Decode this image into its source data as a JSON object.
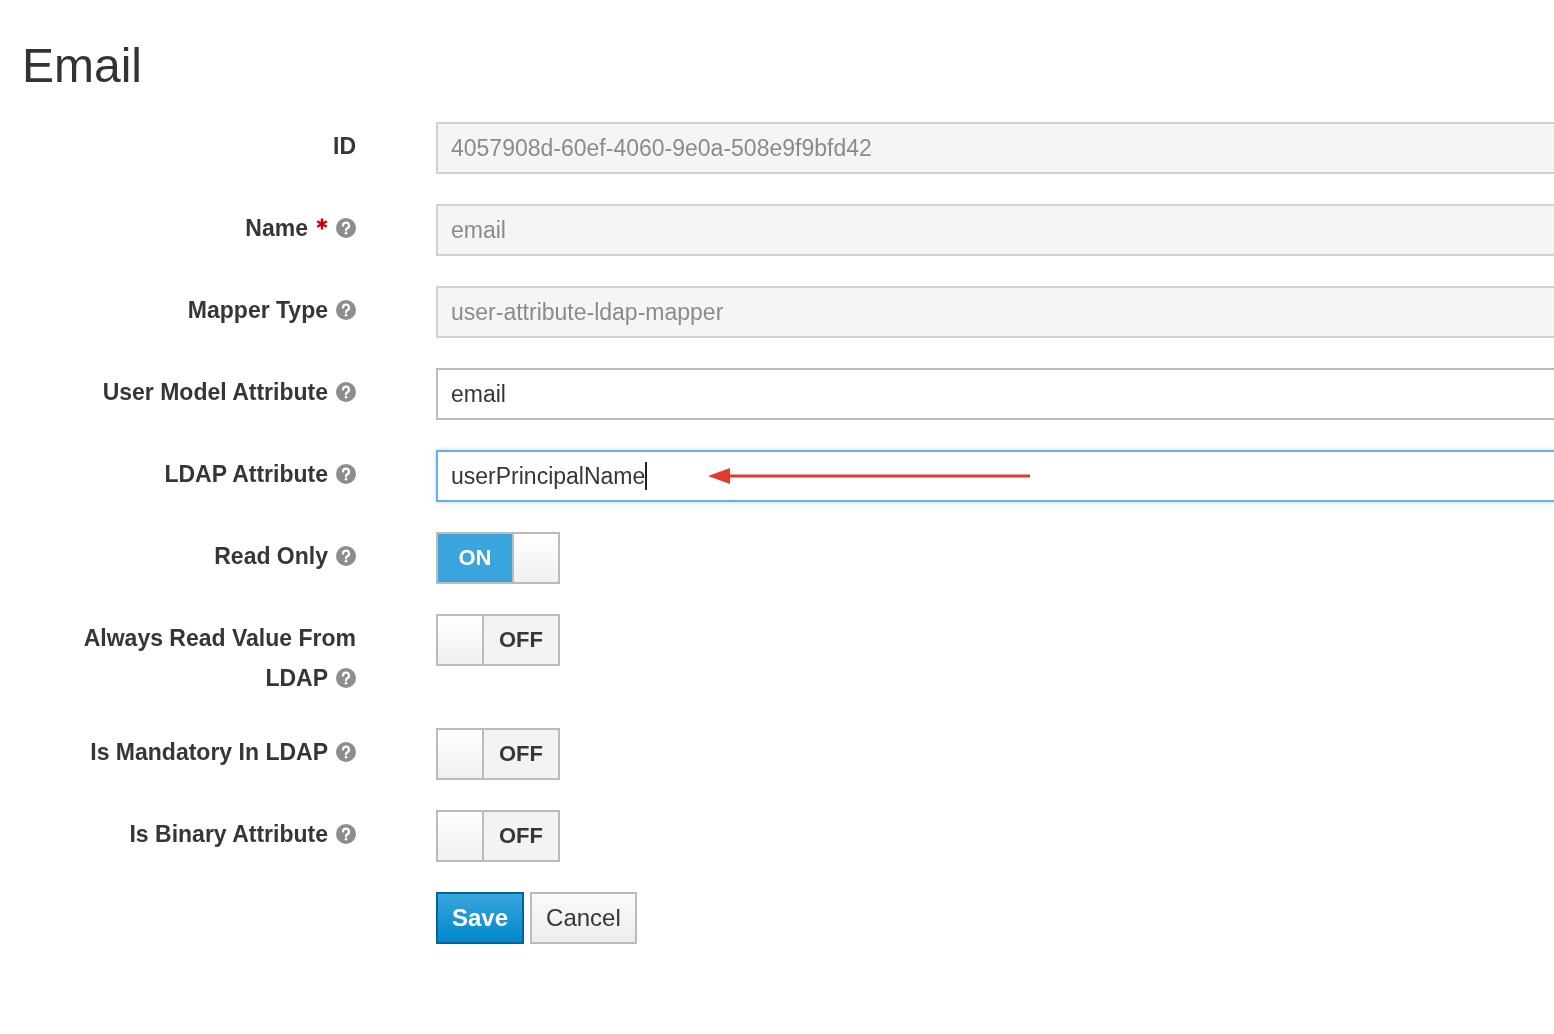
{
  "title": "Email",
  "fields": [
    {
      "kind": "text",
      "label": "ID",
      "required": false,
      "help": false,
      "value": "4057908d-60ef-4060-9e0a-508e9f9bfd42",
      "disabled": true,
      "focused": false,
      "arrow": false
    },
    {
      "kind": "text",
      "label": "Name",
      "required": true,
      "help": true,
      "value": "email",
      "disabled": true,
      "focused": false,
      "arrow": false
    },
    {
      "kind": "text",
      "label": "Mapper Type",
      "required": false,
      "help": true,
      "value": "user-attribute-ldap-mapper",
      "disabled": true,
      "focused": false,
      "arrow": false
    },
    {
      "kind": "text",
      "label": "User Model Attribute",
      "required": false,
      "help": true,
      "value": "email",
      "disabled": false,
      "focused": false,
      "arrow": false
    },
    {
      "kind": "text",
      "label": "LDAP Attribute",
      "required": false,
      "help": true,
      "value": "userPrincipalName",
      "disabled": false,
      "focused": true,
      "arrow": true
    },
    {
      "kind": "switch",
      "label": "Read Only",
      "required": false,
      "help": true,
      "on": true,
      "text": "ON"
    },
    {
      "kind": "switch",
      "label": "Always Read Value From LDAP",
      "required": false,
      "help": true,
      "on": false,
      "text": "OFF"
    },
    {
      "kind": "switch",
      "label": "Is Mandatory In LDAP",
      "required": false,
      "help": true,
      "on": false,
      "text": "OFF"
    },
    {
      "kind": "switch",
      "label": "Is Binary Attribute",
      "required": false,
      "help": true,
      "on": false,
      "text": "OFF"
    }
  ],
  "buttons": [
    {
      "label": "Save",
      "primary": true
    },
    {
      "label": "Cancel",
      "primary": false
    }
  ]
}
